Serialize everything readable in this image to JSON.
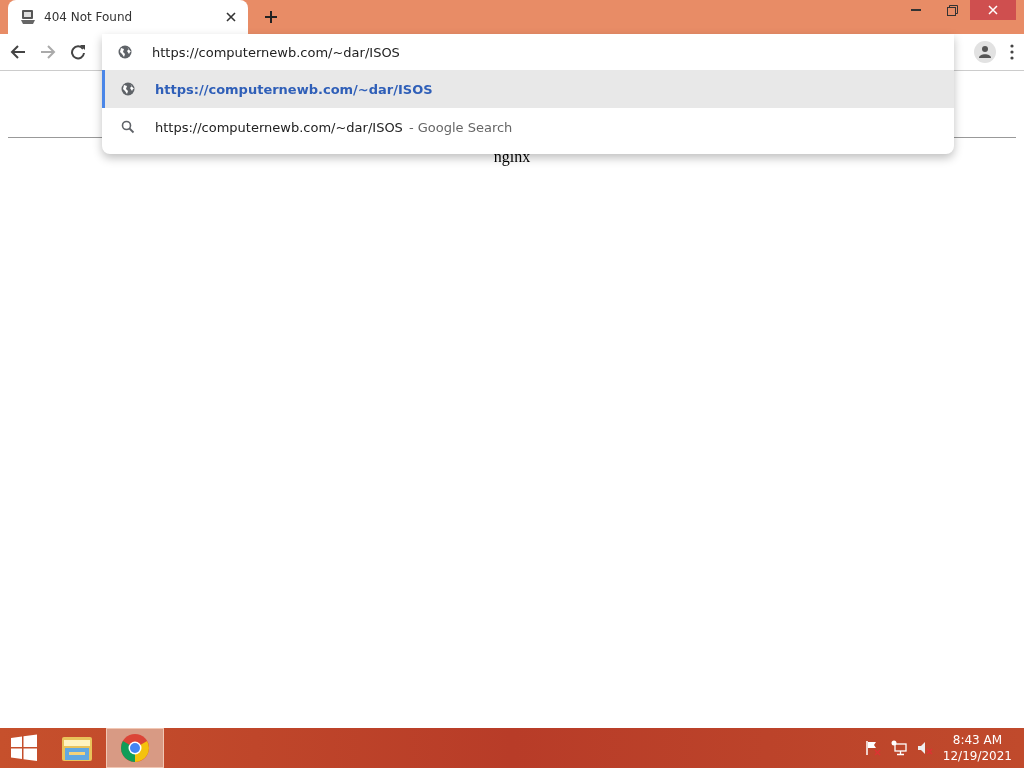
{
  "tab": {
    "title": "404 Not Found"
  },
  "omnibox": {
    "value": "https://computernewb.com/~dar/ISOS"
  },
  "suggestions": [
    {
      "kind": "url",
      "text": "https://computernewb.com/~dar/ISOS",
      "selected": true
    },
    {
      "kind": "search",
      "text": "https://computernewb.com/~dar/ISOS",
      "suffix": "- Google Search",
      "selected": false
    }
  ],
  "page": {
    "footer": "nginx"
  },
  "taskbar": {
    "apps": [
      {
        "kind": "explorer",
        "active": false
      },
      {
        "kind": "chrome",
        "active": true
      }
    ],
    "clock": {
      "time": "8:43 AM",
      "date": "12/19/2021"
    }
  }
}
